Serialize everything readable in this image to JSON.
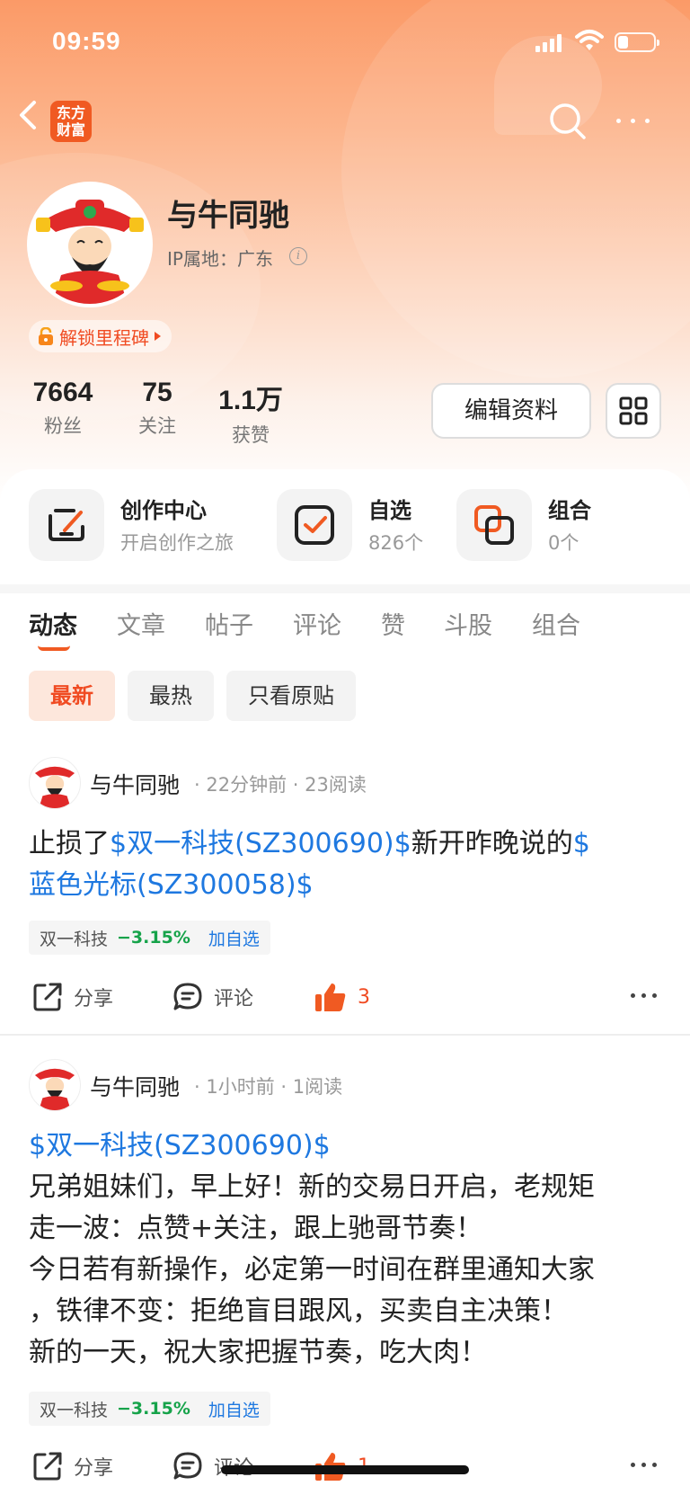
{
  "status_bar": {
    "time": "09:59"
  },
  "header": {
    "logo_line1": "东方",
    "logo_line2": "财富",
    "back_icon": "chevron-left-icon",
    "search_icon": "search-icon",
    "more_icon": "more-horizontal-icon"
  },
  "profile": {
    "name": "与牛同驰",
    "ip_location": "IP属地：广东",
    "milestone_label": "解锁里程碑",
    "stats": [
      {
        "value": "7664",
        "label": "粉丝"
      },
      {
        "value": "75",
        "label": "关注"
      },
      {
        "value": "1.1万",
        "label": "获赞"
      }
    ],
    "edit_label": "编辑资料"
  },
  "tools": [
    {
      "title": "创作中心",
      "subtitle": "开启创作之旅",
      "icon": "create-edit-icon"
    },
    {
      "title": "自选",
      "subtitle": "826个",
      "icon": "checkbox-icon"
    },
    {
      "title": "组合",
      "subtitle": "0个",
      "icon": "portfolio-icon"
    }
  ],
  "tabs": [
    "动态",
    "文章",
    "帖子",
    "评论",
    "赞",
    "斗股",
    "组合"
  ],
  "active_tab": "动态",
  "filters": [
    "最新",
    "最热",
    "只看原贴"
  ],
  "active_filter": "最新",
  "posts": [
    {
      "author": "与牛同驰",
      "meta": "· 22分钟前 · 23阅读",
      "text_1": "止损了",
      "link_1": "$双一科技(SZ300690)$",
      "text_2": "新开昨晚说的",
      "link_2a": "$",
      "link_2b": "蓝色光标(SZ300058)$",
      "stock_name": "双一科技",
      "stock_change": "−3.15%",
      "add_label": "加自选",
      "share_label": "分享",
      "comment_label": "评论",
      "like_count": "3"
    },
    {
      "author": "与牛同驰",
      "meta": "· 1小时前 · 1阅读",
      "link_1": "$双一科技(SZ300690)$",
      "lines": [
        "兄弟姐妹们，早上好！新的交易日开启，老规矩",
        "走一波：点赞+关注，跟上驰哥节奏！",
        "今日若有新操作，必定第一时间在群里通知大家",
        "，铁律不变：拒绝盲目跟风，买卖自主决策！",
        "新的一天，祝大家把握节奏，吃大肉！"
      ],
      "stock_name": "双一科技",
      "stock_change": "−3.15%",
      "add_label": "加自选",
      "share_label": "分享",
      "comment_label": "评论",
      "like_count": "1"
    }
  ],
  "colors": {
    "accent": "#f05a22",
    "link": "#1e78e0",
    "down": "#16a34a"
  }
}
